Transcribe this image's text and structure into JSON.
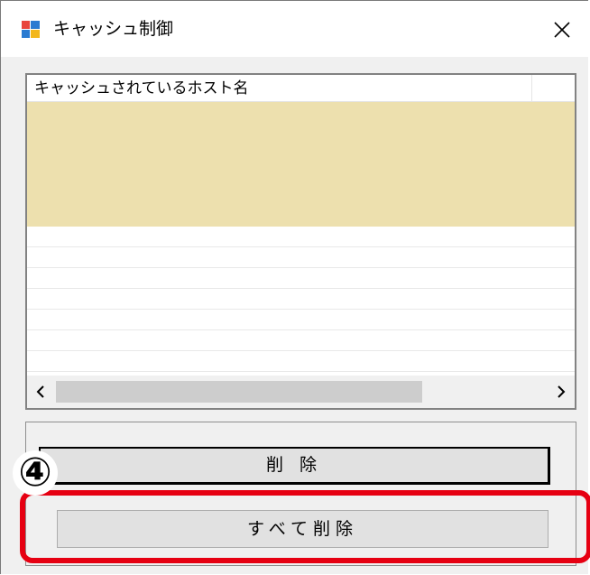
{
  "window": {
    "title": "キャッシュ制御",
    "close_glyph": "✕"
  },
  "list": {
    "column_header": "キャッシュされているホスト名",
    "rows": [
      "",
      "",
      "",
      "",
      "",
      "",
      "",
      "",
      "",
      "",
      "",
      "",
      ""
    ],
    "selected_row_count": 6
  },
  "scrollbar": {
    "left_glyph": "‹",
    "right_glyph": "›"
  },
  "buttons": {
    "delete_label": "削 除",
    "delete_all_label": "すべて削除"
  },
  "annotation": {
    "marker": "④",
    "highlight_color": "#e60012"
  }
}
